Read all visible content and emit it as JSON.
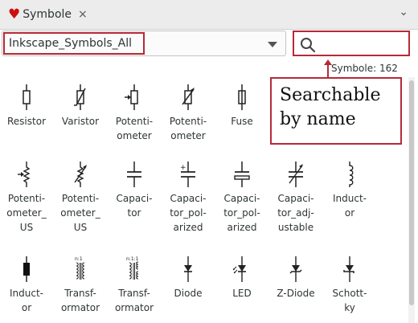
{
  "tab": {
    "icon": "heart-icon",
    "title": "Symbole",
    "close": "×"
  },
  "header": {
    "menu_icon": "chevron-down-icon"
  },
  "symbol_set": {
    "value": "Inkscape_Symbols_All"
  },
  "search": {
    "value": "",
    "placeholder": ""
  },
  "count_label": "Symbole: 162",
  "callout": {
    "line1": "Searchable",
    "line2": "by name"
  },
  "symbols": [
    {
      "icon": "resistor-icon",
      "label": "Resistor"
    },
    {
      "icon": "varistor-icon",
      "label": "Varistor"
    },
    {
      "icon": "potentiometer-icon",
      "label": "Potenti-\nometer"
    },
    {
      "icon": "potentiometer-variable-icon",
      "label": "Potenti-\nometer"
    },
    {
      "icon": "fuse-icon",
      "label": "Fuse"
    },
    {
      "icon": "potentiometer-us-icon",
      "label": "Potenti-\nometer_\nUS"
    },
    {
      "icon": "potentiometer-us-variable-icon",
      "label": "Potenti-\nometer_\nUS"
    },
    {
      "icon": "capacitor-icon",
      "label": "Capaci-\ntor"
    },
    {
      "icon": "capacitor-polarized-icon",
      "label": "Capaci-\ntor_pol-\narized"
    },
    {
      "icon": "capacitor-polarized-alt-icon",
      "label": "Capaci-\ntor_pol-\narized"
    },
    {
      "icon": "capacitor-adjustable-icon",
      "label": "Capaci-\ntor_adj-\nustable"
    },
    {
      "icon": "inductor-icon",
      "label": "Induct-\nor"
    },
    {
      "icon": "inductor-core-icon",
      "label": "Induct-\nor"
    },
    {
      "icon": "transformer-icon",
      "label": "Transf-\normator"
    },
    {
      "icon": "transformer-alt-icon",
      "label": "Transf-\normator"
    },
    {
      "icon": "diode-icon",
      "label": "Diode"
    },
    {
      "icon": "led-icon",
      "label": "LED"
    },
    {
      "icon": "zener-diode-icon",
      "label": "Z-Diode"
    },
    {
      "icon": "schottky-diode-icon",
      "label": "Schott-\nky"
    }
  ]
}
